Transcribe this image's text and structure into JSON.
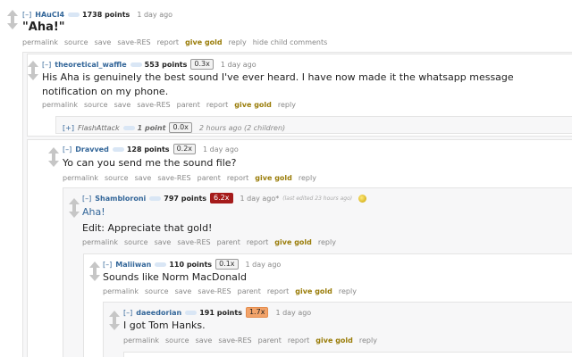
{
  "comments": {
    "c1": {
      "expand": "[–]",
      "author": "HAuCl4",
      "score": "1738 points",
      "time": "1 day ago",
      "body": "\"Aha!\"",
      "buttons": [
        "permalink",
        "source",
        "save",
        "save-RES",
        "report",
        "give gold",
        "reply",
        "hide child comments"
      ]
    },
    "c2": {
      "expand": "[–]",
      "author": "theoretical_waffle",
      "score": "553 points",
      "ratio": "0.3x",
      "time": "1 day ago",
      "body": "His Aha is genuinely the best sound I've ever heard. I have now made it the whatsapp message notification on my phone.",
      "buttons": [
        "permalink",
        "source",
        "save",
        "save-RES",
        "parent",
        "report",
        "give gold",
        "reply"
      ]
    },
    "c3": {
      "expand": "[+]",
      "author": "FlashAttack",
      "score": "1 point",
      "ratio": "0.0x",
      "time": "2 hours ago (2 children)"
    },
    "c4": {
      "expand": "[–]",
      "author": "Dravved",
      "score": "128 points",
      "ratio": "0.2x",
      "time": "1 day ago",
      "body": "Yo can you send me the sound file?",
      "buttons": [
        "permalink",
        "source",
        "save",
        "save-RES",
        "parent",
        "report",
        "give gold",
        "reply"
      ]
    },
    "c5": {
      "expand": "[–]",
      "author": "Shambloroni",
      "score": "797 points",
      "ratio": "6.2x",
      "time": "1 day ago*",
      "edited": "(last edited 23 hours ago)",
      "body1": "Aha!",
      "body2": "Edit: Appreciate that gold!",
      "buttons": [
        "permalink",
        "source",
        "save",
        "save-RES",
        "parent",
        "report",
        "give gold",
        "reply"
      ]
    },
    "c6": {
      "expand": "[–]",
      "author": "Maliiwan",
      "score": "110 points",
      "ratio": "0.1x",
      "time": "1 day ago",
      "body": "Sounds like Norm MacDonald",
      "buttons": [
        "permalink",
        "source",
        "save",
        "save-RES",
        "parent",
        "report",
        "give gold",
        "reply"
      ]
    },
    "c7": {
      "expand": "[–]",
      "author": "daeedorian",
      "score": "191 points",
      "ratio": "1.7x",
      "time": "1 day ago",
      "body": "I got Tom Hanks.",
      "buttons": [
        "permalink",
        "source",
        "save",
        "save-RES",
        "parent",
        "report",
        "give gold",
        "reply"
      ]
    }
  },
  "colors": {
    "link": "#336699",
    "gold": "#9a7d0a",
    "ratio_red": "#a51b1b",
    "ratio_orange": "#f2a36a"
  }
}
